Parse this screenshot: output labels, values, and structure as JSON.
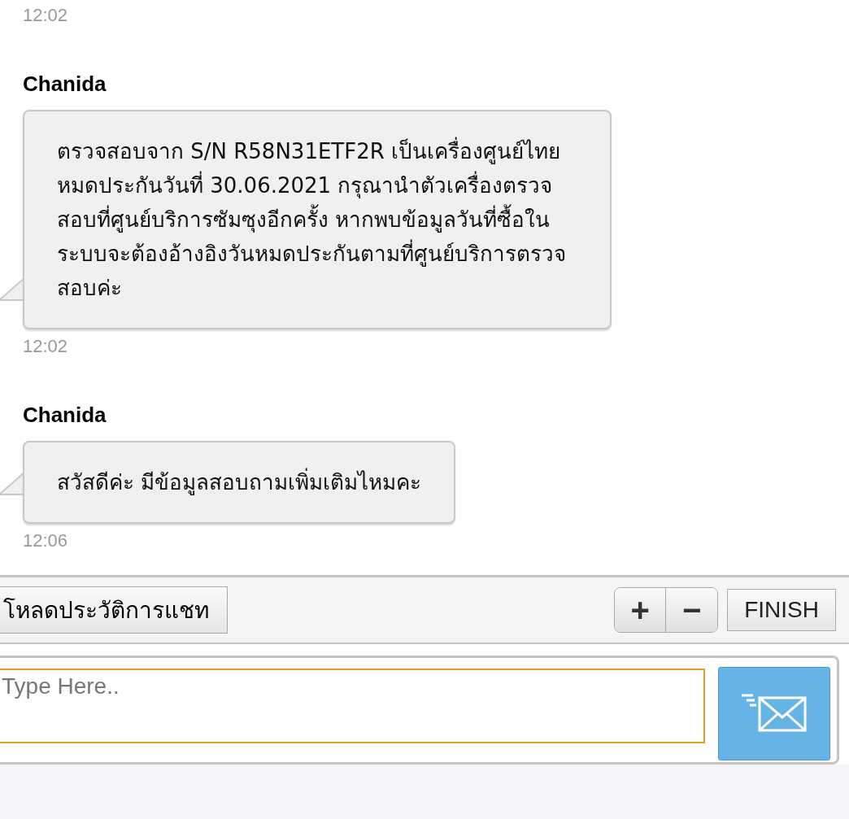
{
  "messages": [
    {
      "time": "12:02"
    },
    {
      "sender": "Chanida",
      "text": "ตรวจสอบจาก S/N R58N31ETF2R เป็นเครื่องศูนย์ไทย หมดประกันวันที่ 30.06.2021 กรุณานำตัวเครื่องตรวจสอบที่ศูนย์บริการซัมซุงอีกครั้ง หากพบข้อมูลวันที่ซื้อในระบบจะต้องอ้างอิงวันหมดประกันตามที่ศูนย์บริการตรวจสอบค่ะ",
      "time": "12:02"
    },
    {
      "sender": "Chanida",
      "text": "สวัสดีค่ะ มีข้อมูลสอบถามเพิ่มเติมไหมคะ",
      "time": "12:06"
    }
  ],
  "toolbar": {
    "history_button": "โหลดประวัติการแชท",
    "zoom_in": "+",
    "zoom_out": "−",
    "finish_button": "FINISH"
  },
  "composer": {
    "placeholder": "Type Here.."
  }
}
